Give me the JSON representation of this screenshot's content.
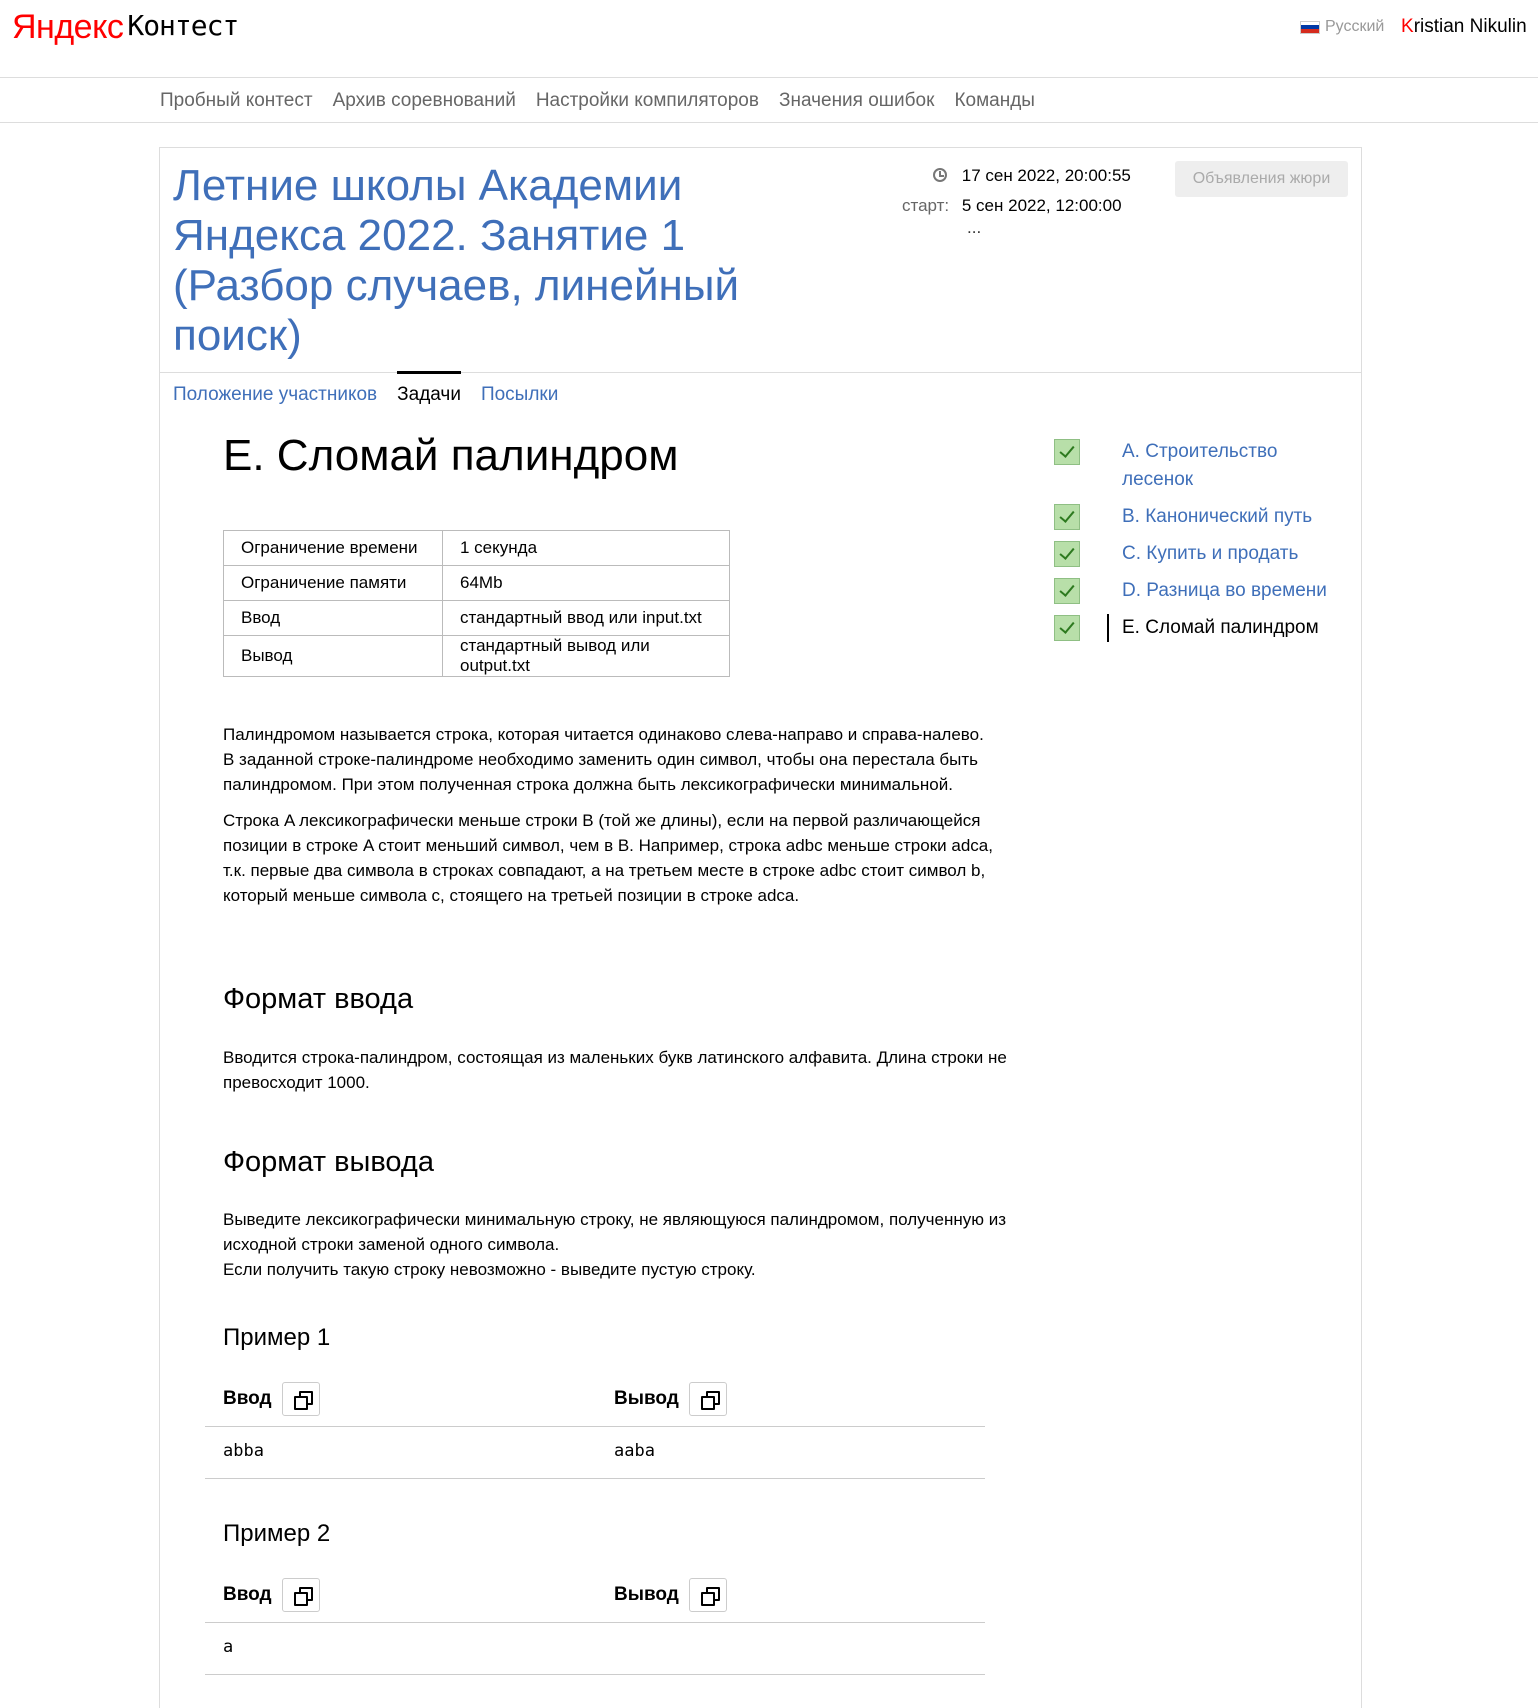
{
  "header": {
    "logo_ya": "Яндекс",
    "logo_rest": "Контест",
    "language": "Русский",
    "user_first_letter": "K",
    "user_rest": "ristian Nikulin"
  },
  "nav": {
    "items": [
      "Пробный контест",
      "Архив соревнований",
      "Настройки компиляторов",
      "Значения ошибок",
      "Команды"
    ]
  },
  "contest": {
    "title": "Летние школы Академии Яндекса 2022. Занятие 1 (Разбор случаев, линейный поиск)",
    "current_time": "17 сен 2022, 20:00:55",
    "start_label": "старт:",
    "start_time": "5 сен 2022, 12:00:00",
    "ellipsis": "...",
    "jury_button": "Объявления жюри"
  },
  "tabs": [
    "Положение участников",
    "Задачи",
    "Посылки"
  ],
  "problem": {
    "title": "E. Сломай палиндром",
    "limits": [
      {
        "label": "Ограничение времени",
        "value": "1 секунда"
      },
      {
        "label": "Ограничение памяти",
        "value": "64Mb"
      },
      {
        "label": "Ввод",
        "value": "стандартный ввод или input.txt"
      },
      {
        "label": "Вывод",
        "value": "стандартный вывод или output.txt"
      }
    ],
    "statement_1": "Палиндромом называется строка, которая читается одинаково слева-направо и справа-налево.",
    "statement_2": "В заданной строке-палиндроме необходимо заменить один символ, чтобы она перестала быть палиндромом. При этом полученная строка должна быть лексикографически минимальной.",
    "statement_3": "Строка A лексикографически меньше строки B (той же длины), если на первой различающейся позиции в строке A стоит меньший символ, чем в B. Например, строка adbc меньше строки adca, т.к. первые два символа в строках совпадают, а на третьем месте в строке adbc стоит символ b, который меньше символа c, стоящего на третьей позиции в строке adca.",
    "input_format_title": "Формат ввода",
    "input_format": "Вводится строка-палиндром, состоящая из маленьких букв латинского алфавита. Длина строки не превосходит 1000.",
    "output_format_title": "Формат вывода",
    "output_format_1": "Выведите лексикографически минимальную строку, не являющуюся палиндромом, полученную из исходной строки заменой одного символа.",
    "output_format_2": "Если получить такую строку невозможно - выведите пустую строку.",
    "examples": [
      {
        "title": "Пример 1",
        "input_label": "Ввод",
        "output_label": "Вывод",
        "input": "abba",
        "output": "aaba"
      },
      {
        "title": "Пример 2",
        "input_label": "Ввод",
        "output_label": "Вывод",
        "input": "a",
        "output": ""
      }
    ]
  },
  "problem_list": [
    {
      "name": "A. Строительство лесенок",
      "status": "accepted"
    },
    {
      "name": "B. Канонический путь",
      "status": "accepted"
    },
    {
      "name": "C. Купить и продать",
      "status": "accepted"
    },
    {
      "name": "D. Разница во времени",
      "status": "accepted"
    },
    {
      "name": "E. Сломай палиндром",
      "status": "accepted",
      "current": true
    }
  ],
  "colors": {
    "link": "#3f6fb9",
    "logo_red": "#ff0000",
    "check_green": "#b8dfa9"
  }
}
